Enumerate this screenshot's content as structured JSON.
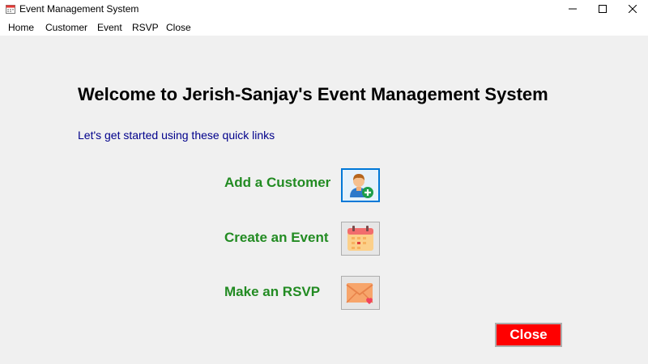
{
  "window": {
    "title": "Event Management System",
    "icon": "calendar-icon"
  },
  "menu": {
    "items": [
      "Home",
      "Customer",
      "Event",
      "RSVP",
      "Close"
    ]
  },
  "main": {
    "welcome": "Welcome to Jerish-Sanjay's Event Management System",
    "subtitle": "Let's get started using these quick links",
    "links": [
      {
        "label": "Add a Customer",
        "icon": "add-user-icon"
      },
      {
        "label": "Create an Event",
        "icon": "calendar-icon"
      },
      {
        "label": "Make an RSVP",
        "icon": "envelope-icon"
      }
    ],
    "close_label": "Close"
  },
  "colors": {
    "link_text": "#228b22",
    "subtitle_text": "#00008b",
    "close_button": "#ff0000"
  }
}
